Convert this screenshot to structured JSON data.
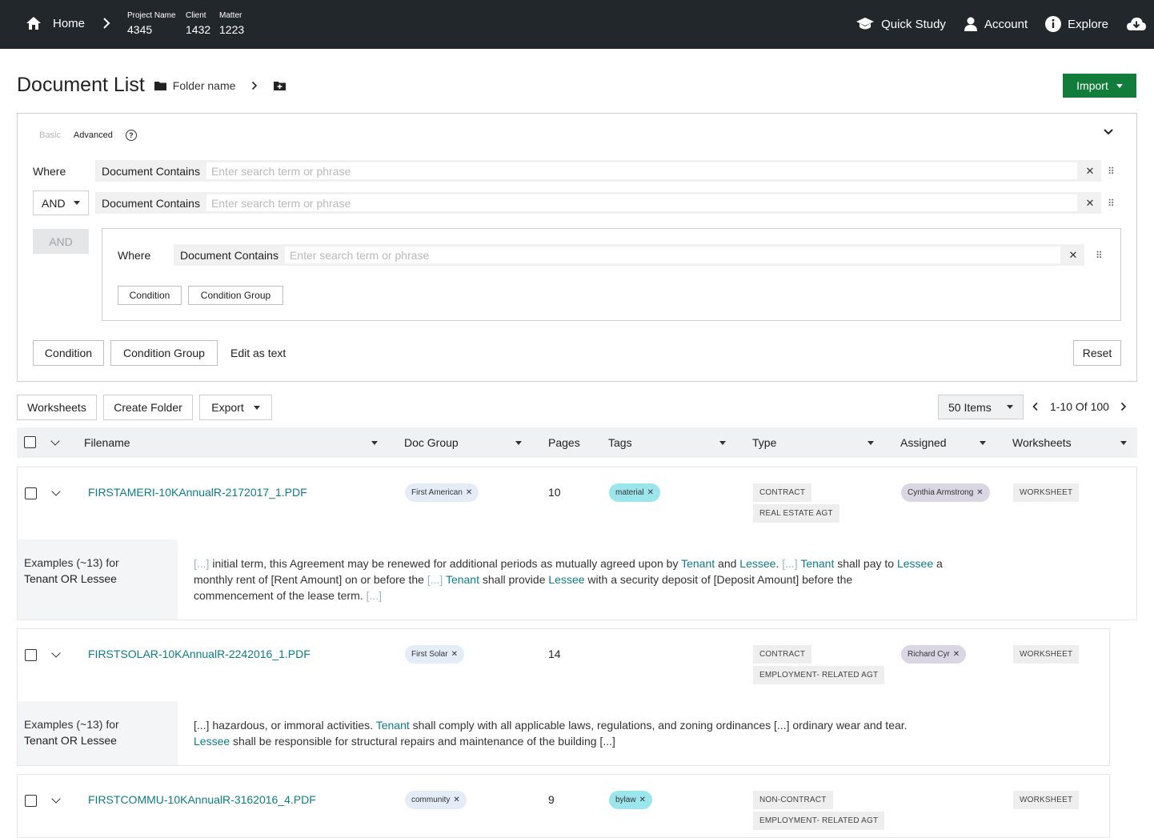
{
  "topbar": {
    "home": "Home",
    "project_label": "Project Name",
    "project_value": "4345",
    "client_label": "Client",
    "client_value": "1432",
    "matter_label": "Matter",
    "matter_value": "1223",
    "quick_study": "Quick Study",
    "account": "Account",
    "explore": "Explore"
  },
  "page": {
    "title": "Document List",
    "folder_name": "Folder name",
    "import_label": "Import"
  },
  "search": {
    "mode_basic": "Basic",
    "mode_advanced": "Advanced",
    "where": "Where",
    "and_operator": "AND",
    "and_disabled": "AND",
    "field_label": "Document Contains",
    "placeholder": "Enter search term or phrase",
    "condition": "Condition",
    "condition_group": "Condition Group",
    "edit_as_text": "Edit as text",
    "reset": "Reset"
  },
  "toolbar": {
    "worksheets": "Worksheets",
    "create_folder": "Create Folder",
    "export": "Export",
    "items_per_page": "50 Items",
    "range": "1-10 Of 100"
  },
  "table": {
    "columns": {
      "filename": "Filename",
      "doc_group": "Doc Group",
      "pages": "Pages",
      "tags": "Tags",
      "type": "Type",
      "assigned": "Assigned",
      "worksheets": "Worksheets"
    },
    "rows": [
      {
        "filename": "FIRSTAMERI-10KAnnualR-2172017_1.PDF",
        "doc_group": "First American",
        "pages": "10",
        "tag": "material",
        "type1": "CONTRACT",
        "type2": "REAL ESTATE AGT",
        "assigned": "Cynthia Armstrong",
        "worksheet": "WORKSHEET",
        "examples_label": "Examples (~13) for",
        "examples_query": "Tenant OR Lessee"
      },
      {
        "filename": "FIRSTSOLAR-10KAnnualR-2242016_1.PDF",
        "doc_group": "First Solar",
        "pages": "14",
        "type1": "CONTRACT",
        "type2": "EMPLOYMENT- RELATED AGT",
        "assigned": "Richard Cyr",
        "worksheet": "WORKSHEET",
        "examples_label": "Examples (~13) for",
        "examples_query": "Tenant OR Lessee"
      },
      {
        "filename": "FIRSTCOMMU-10KAnnualR-3162016_4.PDF",
        "doc_group": "community",
        "pages": "9",
        "tag": "bylaw",
        "type1": "NON-CONTRACT",
        "type2": "EMPLOYMENT- RELATED AGT",
        "worksheet": "WORKSHEET"
      }
    ],
    "snippets": {
      "r1_l1_a": "[...]",
      "r1_l1_b": " initial term, this Agreement may be renewed for additional periods as mutually agreed upon by ",
      "r1_l1_c": "Tenant",
      "r1_l1_d": " and ",
      "r1_l1_e": "Lessee",
      "r1_l1_f": ". ",
      "r1_l1_g": "[...]",
      "r1_l1_h": " ",
      "r1_l1_i": "Tenant",
      "r1_l1_j": " shall pay to ",
      "r1_l1_k": "Lessee",
      "r1_l1_l": " a",
      "r1_l2_a": "monthly rent of [Rent Amount] on or before the ",
      "r1_l2_b": "[...]",
      "r1_l2_c": " ",
      "r1_l2_d": "Tenant",
      "r1_l2_e": " shall provide ",
      "r1_l2_f": "Lessee",
      "r1_l2_g": " with a security deposit of [Deposit Amount] before the",
      "r1_l3_a": "commencement of the lease term. ",
      "r1_l3_b": "[...]",
      "r2_l1_a": "[...] hazardous, or immoral activities. ",
      "r2_l1_b": "Tenant",
      "r2_l1_c": " shall comply with all applicable laws, regulations, and zoning ordinances [...] ordinary wear and tear.",
      "r2_l2_a": "Lessee",
      "r2_l2_b": " shall be responsible for structural repairs and maintenance of the building [...]"
    }
  }
}
